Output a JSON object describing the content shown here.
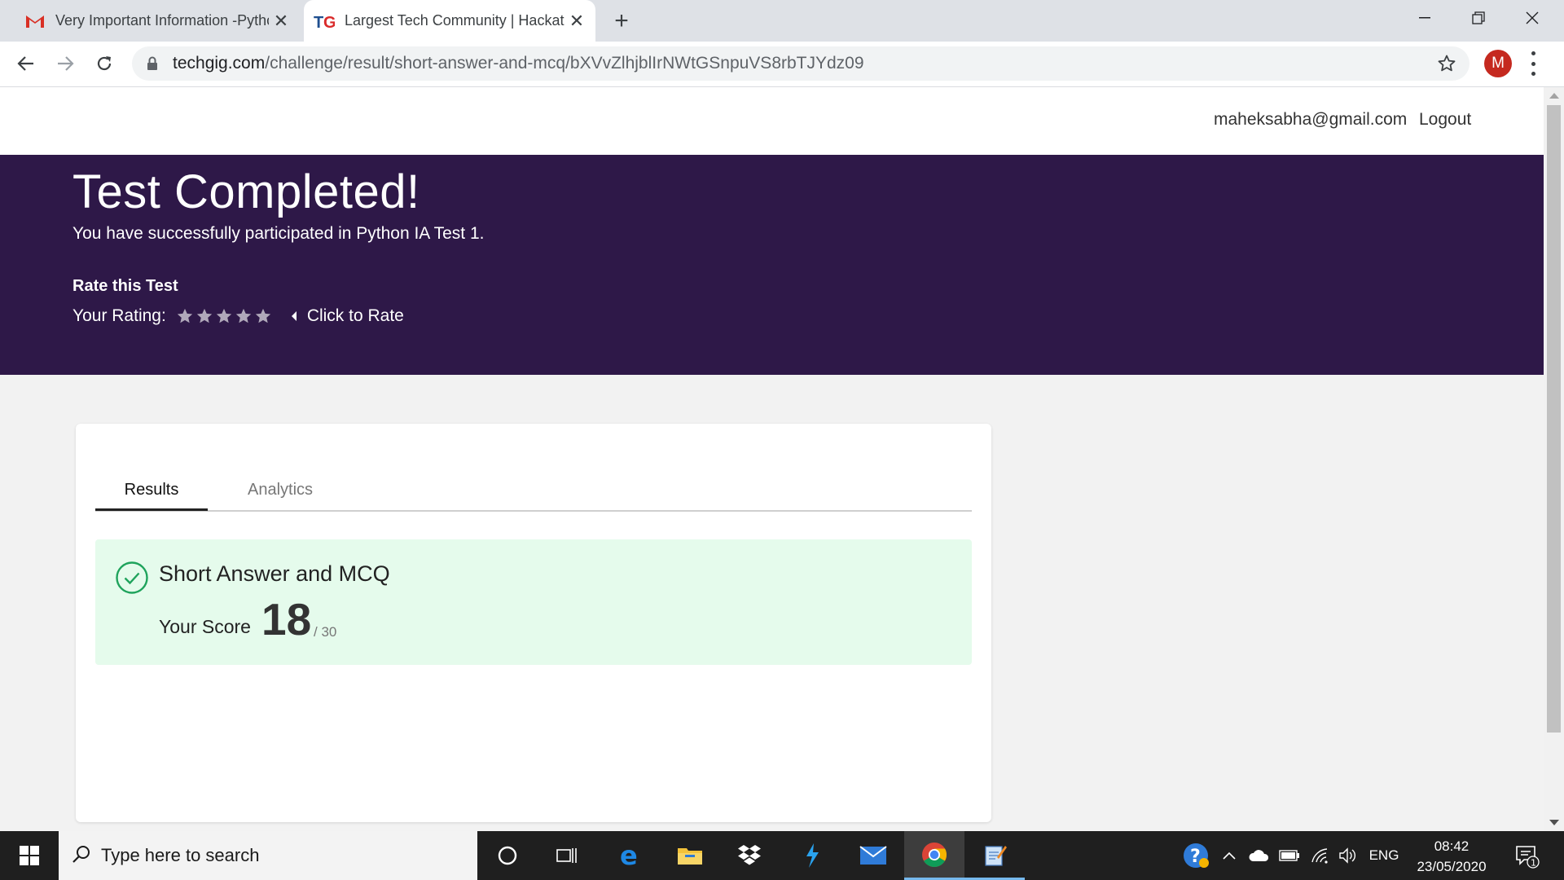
{
  "browser": {
    "tabs": [
      {
        "title": "Very Important Information -Python",
        "icon": "gmail-icon",
        "active": false
      },
      {
        "title": "Largest Tech Community | Hackathon",
        "icon": "techgig-icon",
        "active": true
      }
    ],
    "new_tab": "+",
    "url_host": "techgig.com",
    "url_path": "/challenge/result/short-answer-and-mcq/bXVvZlhjblIrNWtGSnpuVS8rbTJYdz09",
    "profile_initial": "M",
    "accent": "#c5291f"
  },
  "site_header": {
    "email": "maheksabha@gmail.com",
    "logout": "Logout"
  },
  "hero": {
    "title": "Test Completed!",
    "subtitle": "You have successfully participated in Python IA Test 1.",
    "rate_heading": "Rate this Test",
    "rating_label": "Your Rating:",
    "rating_value": 0,
    "rating_max": 5,
    "click_to_rate": "Click to Rate",
    "background": "#2e1848"
  },
  "results": {
    "tabs": [
      "Results",
      "Analytics"
    ],
    "section_title": "Short Answer and MCQ",
    "score_label": "Your Score",
    "score": "18",
    "out_of": "/ 30",
    "box_color": "#e5fbec",
    "check_color": "#1fa35c"
  },
  "taskbar": {
    "search_placeholder": "Type here to search",
    "language": "ENG",
    "time": "08:42",
    "date": "23/05/2020",
    "notification_count": "1"
  }
}
